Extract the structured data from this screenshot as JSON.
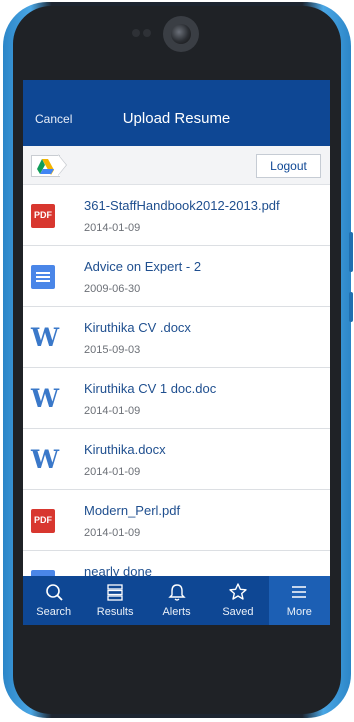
{
  "header": {
    "cancel_label": "Cancel",
    "title": "Upload Resume"
  },
  "toolbar": {
    "logout_label": "Logout",
    "breadcrumb_icon": "google-drive-icon"
  },
  "files": [
    {
      "icon": "pdf-icon",
      "icon_text": "PDF",
      "name": "361-StaffHandbook2012-2013.pdf",
      "date": "2014-01-09"
    },
    {
      "icon": "google-doc-icon",
      "name": "Advice on Expert - 2",
      "date": "2009-06-30"
    },
    {
      "icon": "word-icon",
      "icon_text": "W",
      "name": "Kiruthika CV .docx",
      "date": "2015-09-03"
    },
    {
      "icon": "word-icon",
      "icon_text": "W",
      "name": "Kiruthika CV 1 doc.doc",
      "date": "2014-01-09"
    },
    {
      "icon": "word-icon",
      "icon_text": "W",
      "name": "Kiruthika.docx",
      "date": "2014-01-09"
    },
    {
      "icon": "pdf-icon",
      "icon_text": "PDF",
      "name": "Modern_Perl.pdf",
      "date": "2014-01-09"
    },
    {
      "icon": "google-doc-icon",
      "name": "nearly done",
      "date": ""
    }
  ],
  "nav": [
    {
      "label": "Search",
      "icon": "search-icon"
    },
    {
      "label": "Results",
      "icon": "results-icon"
    },
    {
      "label": "Alerts",
      "icon": "bell-icon"
    },
    {
      "label": "Saved",
      "icon": "star-icon"
    },
    {
      "label": "More",
      "icon": "menu-icon",
      "active": true
    }
  ],
  "colors": {
    "brand": "#0e4794",
    "active_tab": "#1c5fb4",
    "link_text": "#1f4f8f"
  }
}
